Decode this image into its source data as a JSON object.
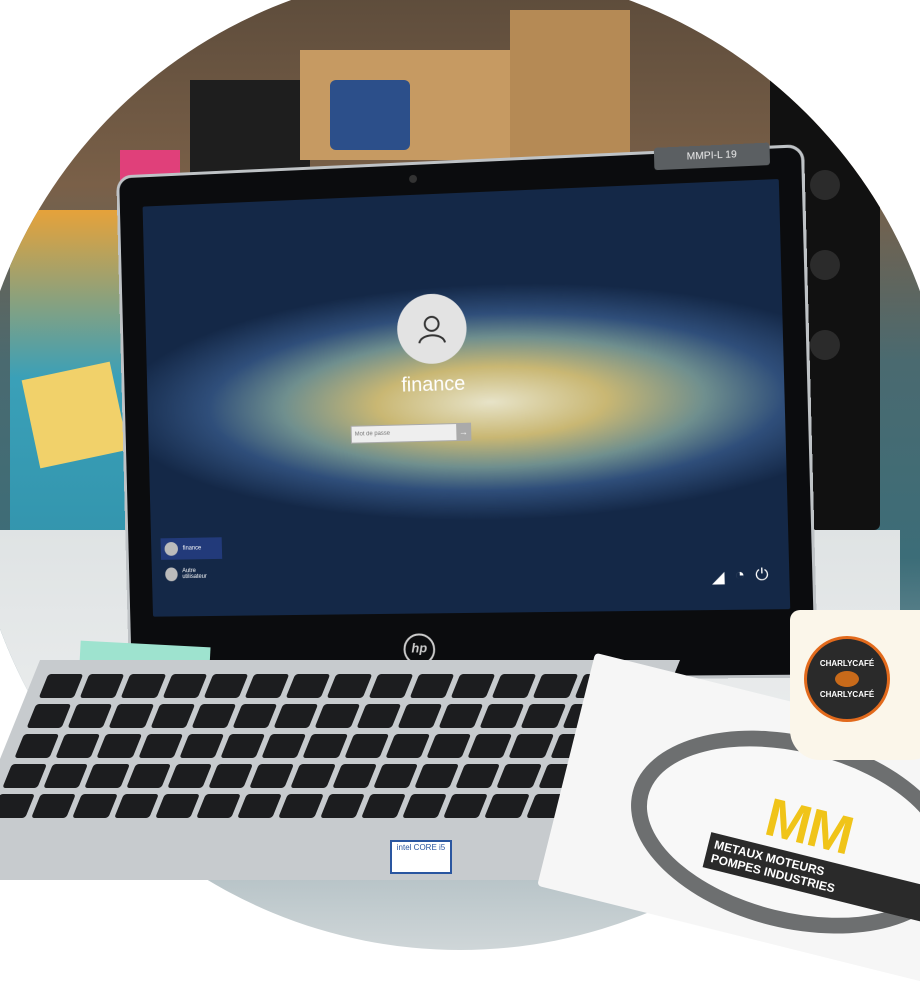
{
  "screen": {
    "asset_label": "MMPI-L 19",
    "username": "finance",
    "password_placeholder": "Mot de passe",
    "users": [
      {
        "label": "finance"
      },
      {
        "label": "Autre utilisateur"
      }
    ],
    "system_icons": [
      "network-icon",
      "accessibility-icon",
      "power-icon"
    ]
  },
  "laptop": {
    "brand_logo": "hp",
    "intel_sticker": "intel CORE i5"
  },
  "cup": {
    "brand_top": "CHARLYCAFÉ",
    "brand_bottom": "CHARLYCAFÉ"
  },
  "document": {
    "logo_letters": "MM",
    "logo_line1": "METAUX MOTEURS",
    "logo_line2": "POMPES INDUSTRIES"
  },
  "colors": {
    "accent_blue": "#223a7a",
    "mm_yellow": "#f0c419",
    "cafe_orange": "#e26a1c"
  }
}
